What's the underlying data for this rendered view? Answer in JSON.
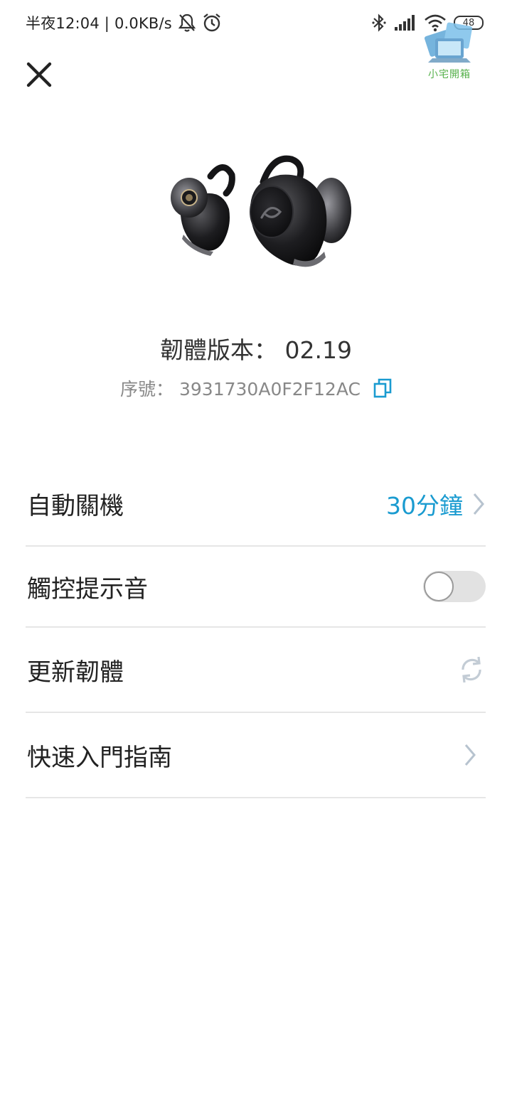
{
  "status_bar": {
    "time_text": "半夜12:04 | 0.0KB/s",
    "battery": "48",
    "icons": [
      "bell-off-icon",
      "alarm-icon",
      "bluetooth-icon",
      "signal-icon",
      "wifi-icon",
      "battery-icon"
    ]
  },
  "watermark": {
    "text": "小宅開箱"
  },
  "header": {
    "close_icon": "close-icon"
  },
  "device": {
    "firmware_label": "韌體版本：",
    "firmware_version": "02.19",
    "serial_label": "序號：",
    "serial_number": "3931730A0F2F12AC"
  },
  "settings": {
    "items": [
      {
        "label": "自動關機",
        "value": "30分鐘",
        "control": "chevron"
      },
      {
        "label": "觸控提示音",
        "control": "toggle",
        "state": "off"
      },
      {
        "label": "更新韌體",
        "control": "refresh"
      },
      {
        "label": "快速入門指南",
        "control": "chevron"
      }
    ]
  },
  "colors": {
    "accent": "#1a9bd0",
    "divider": "#e6e6e6",
    "text": "#222222",
    "muted": "#888888"
  }
}
